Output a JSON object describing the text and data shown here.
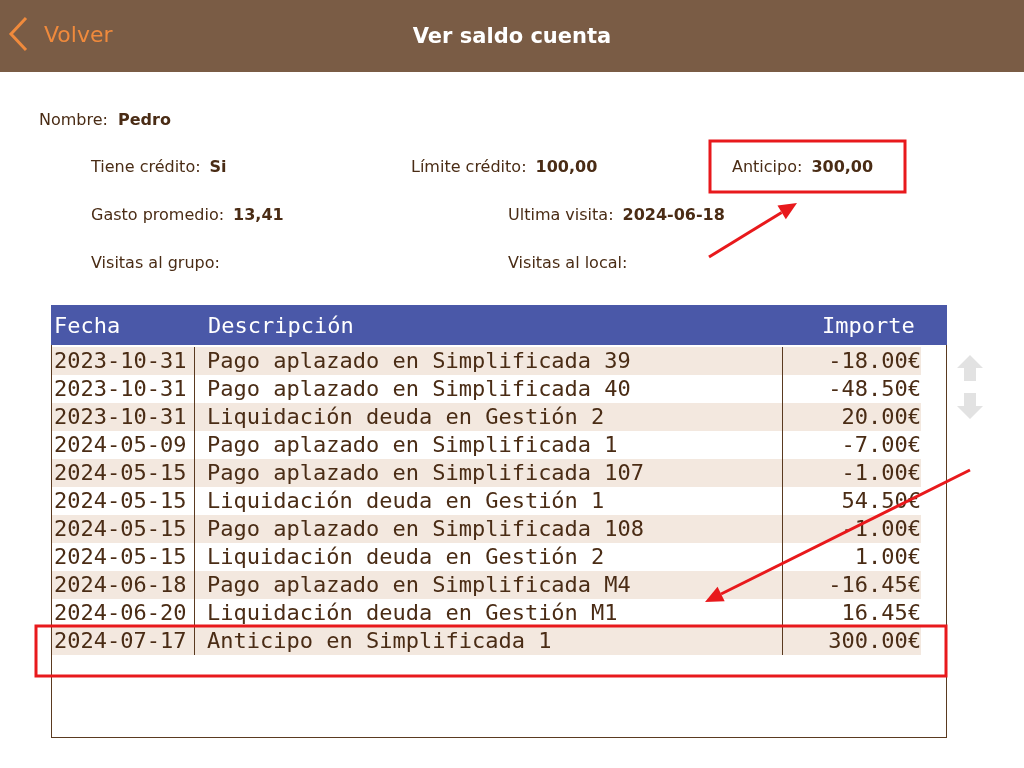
{
  "header": {
    "back_label": "Volver",
    "title": "Ver saldo cuenta"
  },
  "name_field": {
    "label": "Nombre:",
    "value": "Pedro"
  },
  "info_rows": [
    [
      {
        "label": "Tiene crédito:",
        "value": "Si"
      },
      {
        "label": "Límite crédito:",
        "value": "100,00"
      },
      {
        "label": "Anticipo:",
        "value": "300,00"
      }
    ],
    [
      {
        "label": "Gasto promedio:",
        "value": "13,41"
      },
      {
        "label": "Ultima visita:",
        "value": "2024-06-18"
      }
    ],
    [
      {
        "label": "Visitas al grupo:"
      },
      {
        "label": "Visitas al local:"
      }
    ]
  ],
  "table": {
    "columns": [
      "Fecha",
      "Descripción",
      "Importe"
    ],
    "rows": [
      [
        "2023-10-31",
        "Pago aplazado en Simplificada 39",
        "-18.00€"
      ],
      [
        "2023-10-31",
        "Pago aplazado en Simplificada 40",
        "-48.50€"
      ],
      [
        "2023-10-31",
        "Liquidación deuda en Gestión 2",
        "20.00€"
      ],
      [
        "2024-05-09",
        "Pago aplazado en Simplificada 1",
        "-7.00€"
      ],
      [
        "2024-05-15",
        "Pago aplazado en Simplificada 107",
        "-1.00€"
      ],
      [
        "2024-05-15",
        "Liquidación deuda en Gestión 1",
        "54.50€"
      ],
      [
        "2024-05-15",
        "Pago aplazado en Simplificada 108",
        "-1.00€"
      ],
      [
        "2024-05-15",
        "Liquidación deuda en Gestión 2",
        "1.00€"
      ],
      [
        "2024-06-18",
        "Pago aplazado en Simplificada M4",
        "-16.45€"
      ],
      [
        "2024-06-20",
        "Liquidación deuda en Gestión M1",
        "16.45€"
      ],
      [
        "2024-07-17",
        "Anticipo en Simplificada 1",
        "300.00€"
      ]
    ]
  },
  "annotations": [
    {
      "kind": "box"
    },
    {
      "kind": "arrow"
    },
    {
      "kind": "box"
    },
    {
      "kind": "arrow"
    }
  ]
}
